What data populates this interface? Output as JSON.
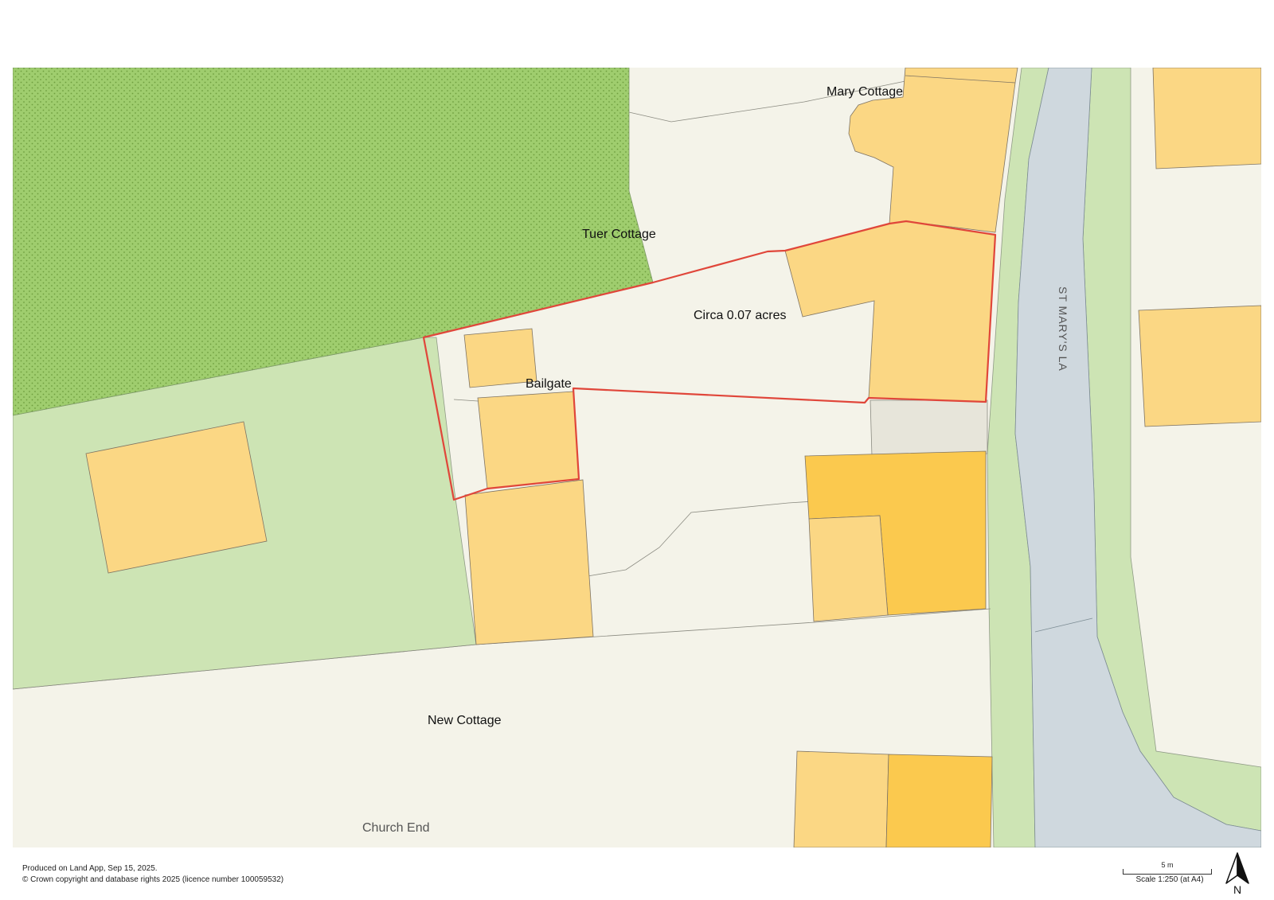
{
  "map": {
    "labels": {
      "mary_cottage": "Mary Cottage",
      "tuer_cottage": "Tuer Cottage",
      "circa_area": "Circa 0.07 acres",
      "bailgate": "Bailgate",
      "new_cottage": "New Cottage",
      "church_end": "Church End",
      "road": "ST MARY'S LA"
    },
    "colors": {
      "background": "#f4f3e9",
      "woodland": "#9fcd6e",
      "grass": "#cde4b4",
      "building": "#fbd784",
      "building_dark": "#fbc94e",
      "road": "#cfd8de",
      "boundary": "#e0463a"
    }
  },
  "footer": {
    "produced": "Produced on Land App, Sep 15, 2025.",
    "copyright": "© Crown copyright and database rights 2025 (licence number 100059532)",
    "scale_distance": "5 m",
    "scale_text": "Scale 1:250 (at A4)",
    "north_label": "N",
    "north_icon": "north-arrow-icon"
  }
}
